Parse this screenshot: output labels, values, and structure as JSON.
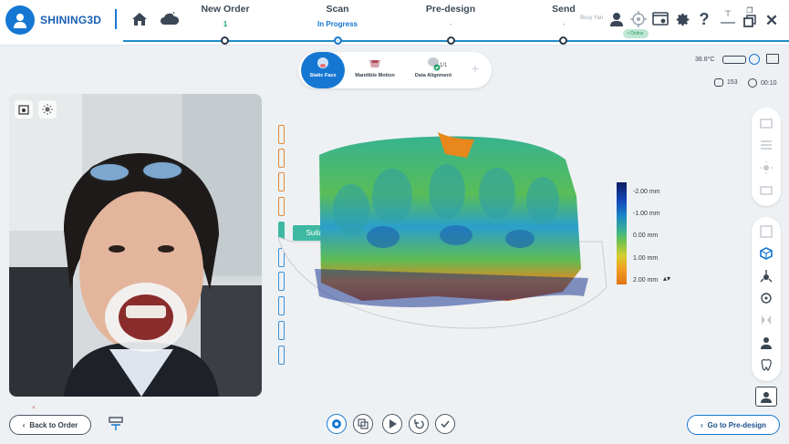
{
  "app": {
    "brand": "SHINING3D",
    "user": "Busy Yan",
    "user_badge": "• Online"
  },
  "steps": [
    {
      "title": "New Order",
      "status": "1"
    },
    {
      "title": "Scan",
      "status": "In Progress"
    },
    {
      "title": "Pre-design",
      "status": "-"
    },
    {
      "title": "Send",
      "status": "-"
    }
  ],
  "modes": [
    {
      "label": "Static Face"
    },
    {
      "label": "Mandible Motion"
    },
    {
      "label": "Data Alignment"
    }
  ],
  "mode_count": "1/1",
  "status": {
    "temperature": "38.8°C",
    "frames": "153",
    "timer": "00:10"
  },
  "markers_tip": "Suitable",
  "scale": [
    "-2.00 mm",
    "-1.00 mm",
    "0.00 mm",
    "1.00 mm",
    "2.00 mm"
  ],
  "buttons": {
    "back": "Back to Order",
    "next": "Go to Pre-design"
  },
  "colors": {
    "accent": "#1677d2",
    "success": "#16a56a",
    "marker_orange": "#e08a34",
    "marker_teal": "#3fb8a3",
    "marker_blue": "#3a8fd6"
  }
}
